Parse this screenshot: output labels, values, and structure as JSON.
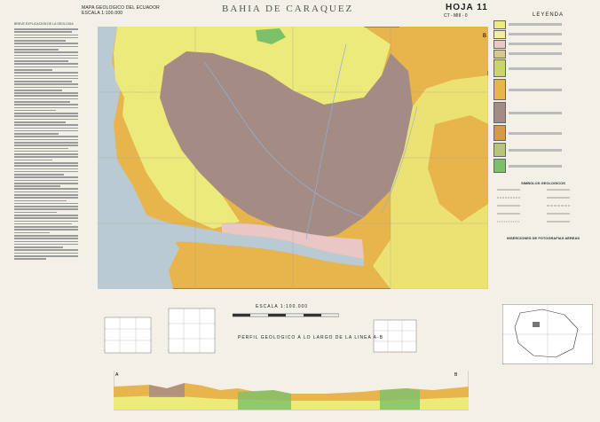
{
  "header": {
    "line1": "MAPA GEOLOGICO DEL ECUADOR",
    "line2": "ESCALA 1:100.000",
    "title": "BAHIA DE CARAQUEZ",
    "sheet": "HOJA 11",
    "code": "CT - MIII - 0",
    "legend": "LEYENDA"
  },
  "notes": {
    "heading": "BREVE EXPLICACION DE LA GEOLOGIA"
  },
  "map_labels": {
    "marker": "B"
  },
  "bottom": {
    "scale": "ESCALA 1:100.000",
    "perfil": "PERFIL GEOLOGICO A LO LARGO DE LA LINEA A-B",
    "section_a": "A",
    "section_b": "B"
  },
  "legend_blocks": {
    "symbols": "SIMBOLOS GEOLOGICOS",
    "photo": "INSERCIONES DE FOTOGRAFIAS AEREAS"
  },
  "colors": {
    "yellow": "#ecea7a",
    "brown": "#a48b84",
    "orange": "#e8b54c",
    "sea": "#b9cad2",
    "green": "#7cc06a"
  }
}
